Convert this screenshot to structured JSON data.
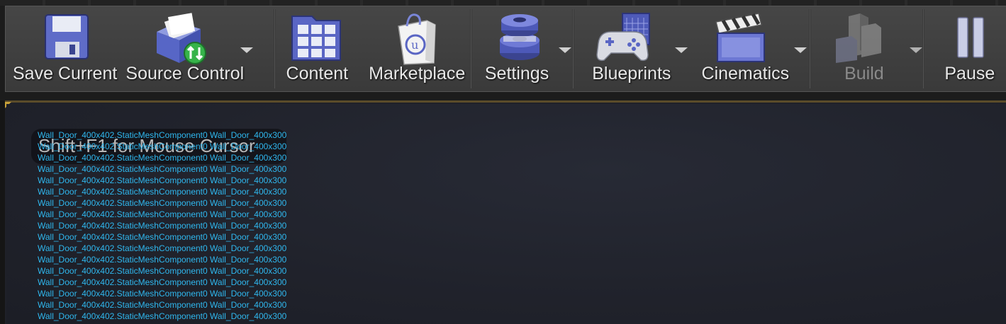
{
  "toolbar": {
    "items": [
      {
        "label": "Save Current",
        "icon": "floppy-disk-icon",
        "dropdown": false,
        "enabled": true
      },
      {
        "label": "Source Control",
        "icon": "source-control-icon",
        "dropdown": true,
        "enabled": true
      },
      {
        "label": "Content",
        "icon": "content-browser-icon",
        "dropdown": false,
        "enabled": true
      },
      {
        "label": "Marketplace",
        "icon": "marketplace-bag-icon",
        "dropdown": false,
        "enabled": true
      },
      {
        "label": "Settings",
        "icon": "settings-gear-icon",
        "dropdown": true,
        "enabled": true
      },
      {
        "label": "Blueprints",
        "icon": "gamepad-blueprint-icon",
        "dropdown": true,
        "enabled": true
      },
      {
        "label": "Cinematics",
        "icon": "clapperboard-icon",
        "dropdown": true,
        "enabled": true
      },
      {
        "label": "Build",
        "icon": "build-blocks-icon",
        "dropdown": true,
        "enabled": false
      },
      {
        "label": "Pause",
        "icon": "pause-icon",
        "dropdown": false,
        "enabled": true
      }
    ]
  },
  "viewport": {
    "hint": "Shift+F1 for Mouse Cursor",
    "debug_line": "Wall_Door_400x402.StaticMeshComponent0 Wall_Door_400x300",
    "debug_lines": [
      "Wall_Door_400x402.StaticMeshComponent0 Wall_Door_400x300",
      "Wall_Door_400x402.StaticMeshComponent0 Wall_Door_400x300",
      "Wall_Door_400x402.StaticMeshComponent0 Wall_Door_400x300",
      "Wall_Door_400x402.StaticMeshComponent0 Wall_Door_400x300",
      "Wall_Door_400x402.StaticMeshComponent0 Wall_Door_400x300",
      "Wall_Door_400x402.StaticMeshComponent0 Wall_Door_400x300",
      "Wall_Door_400x402.StaticMeshComponent0 Wall_Door_400x300",
      "Wall_Door_400x402.StaticMeshComponent0 Wall_Door_400x300",
      "Wall_Door_400x402.StaticMeshComponent0 Wall_Door_400x300",
      "Wall_Door_400x402.StaticMeshComponent0 Wall_Door_400x300",
      "Wall_Door_400x402.StaticMeshComponent0 Wall_Door_400x300",
      "Wall_Door_400x402.StaticMeshComponent0 Wall_Door_400x300",
      "Wall_Door_400x402.StaticMeshComponent0 Wall_Door_400x300",
      "Wall_Door_400x402.StaticMeshComponent0 Wall_Door_400x300",
      "Wall_Door_400x402.StaticMeshComponent0 Wall_Door_400x300",
      "Wall_Door_400x402.StaticMeshComponent0 Wall_Door_400x300",
      "Wall_Door_400x402.StaticMeshComponent0 Wall_Door_400x300",
      "Wall_Door_400x402.StaticMeshComponent0 Wall_Door_400x300"
    ]
  },
  "colors": {
    "accent_corner": "#c9a23a",
    "debug_text": "#2fb7ee"
  }
}
